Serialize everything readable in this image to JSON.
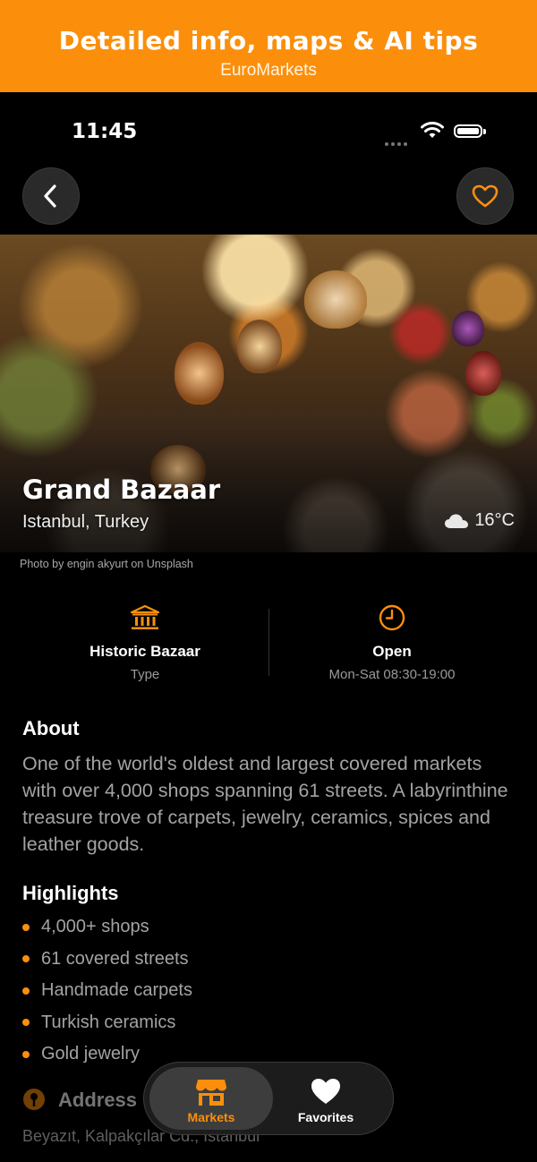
{
  "banner": {
    "title": "Detailed info, maps & AI tips",
    "subtitle": "EuroMarkets"
  },
  "status_bar": {
    "time": "11:45"
  },
  "hero": {
    "title": "Grand Bazaar",
    "location": "Istanbul, Turkey",
    "temperature": "16°C",
    "weather_icon": "cloud-icon",
    "photo_credit": "Photo by engin akyurt on Unsplash"
  },
  "info": {
    "type": {
      "icon": "bank-building-icon",
      "title": "Historic Bazaar",
      "label": "Type"
    },
    "hours": {
      "icon": "clock-icon",
      "title": "Open",
      "label": "Mon-Sat 08:30-19:00"
    }
  },
  "about": {
    "heading": "About",
    "text": "One of the world's oldest and largest covered markets with over 4,000 shops spanning 61 streets. A labyrinthine treasure trove of carpets, jewelry, ceramics, spices and leather goods."
  },
  "highlights": {
    "heading": "Highlights",
    "items": [
      "4,000+ shops",
      "61 covered streets",
      "Handmade carpets",
      "Turkish ceramics",
      "Gold jewelry"
    ]
  },
  "address": {
    "heading": "Address",
    "text": "Beyazıt, Kalpakçılar Cd., Istanbul"
  },
  "tabs": [
    {
      "label": "Markets",
      "icon": "store-icon",
      "active": true
    },
    {
      "label": "Favorites",
      "icon": "heart-icon",
      "active": false
    }
  ],
  "colors": {
    "accent": "#fb8f0b",
    "background": "#000000"
  }
}
